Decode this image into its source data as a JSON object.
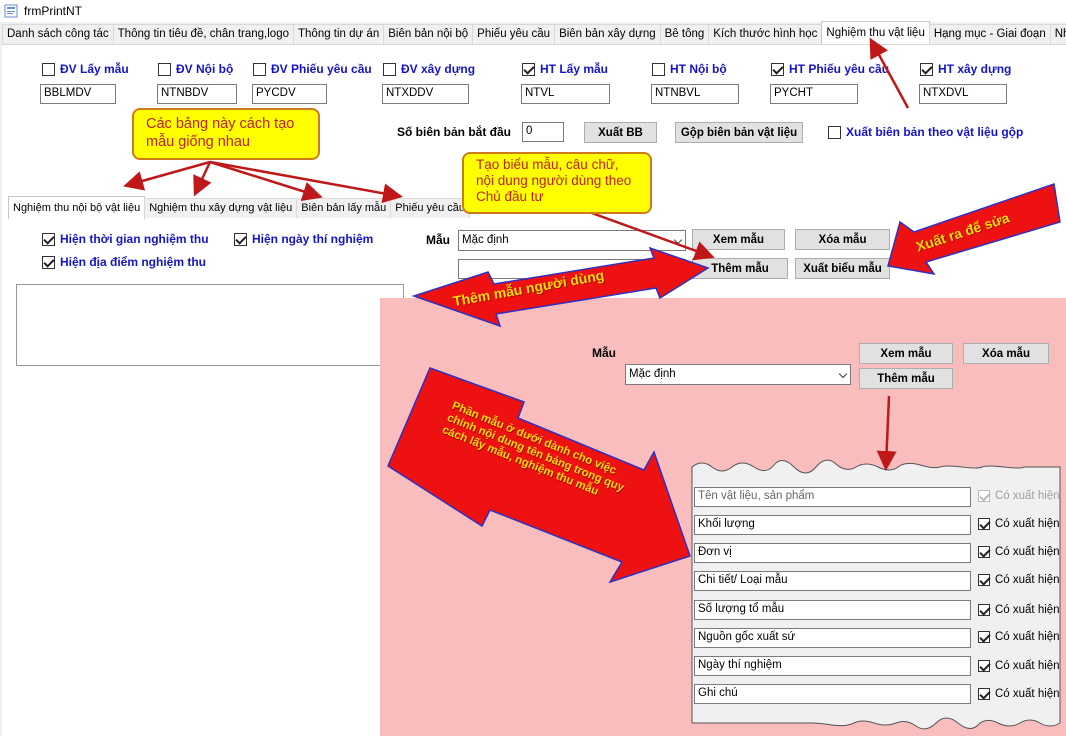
{
  "window": {
    "title": "frmPrintNT"
  },
  "main_tabs": [
    "Danh sách công tác",
    "Thông tin tiêu đề, chân trang,logo",
    "Thông tin dự án",
    "Biên bản nội bộ",
    "Phiếu yêu cầu",
    "Biên bản xây dựng",
    "Bê tông",
    "Kích thước hình học",
    "Nghiệm thu vật liệu",
    "Hạng mục - Giai đoạn",
    "Nhật ký"
  ],
  "active_main_tab": "Nghiệm thu vật liệu",
  "prefix_options": [
    {
      "label": "ĐV Lấy mẫu",
      "checked": false,
      "value": "BBLMDV"
    },
    {
      "label": "ĐV Nội bộ",
      "checked": false,
      "value": "NTNBDV"
    },
    {
      "label": "ĐV Phiếu yêu cầu",
      "checked": false,
      "value": "PYCDV"
    },
    {
      "label": "ĐV xây dựng",
      "checked": false,
      "value": "NTXDDV"
    },
    {
      "label": "HT Lấy mẫu",
      "checked": true,
      "value": "NTVL"
    },
    {
      "label": "HT Nội bộ",
      "checked": false,
      "value": "NTNBVL"
    },
    {
      "label": "HT Phiếu yêu cầu",
      "checked": true,
      "value": "PYCHT"
    },
    {
      "label": "HT xây dựng",
      "checked": true,
      "value": "NTXDVL"
    }
  ],
  "start_number": {
    "label": "Số biên bản bắt đầu",
    "value": "0"
  },
  "buttons": {
    "export_bb": "Xuất BB",
    "merge_bb": "Gộp biên bản vật liệu",
    "view_template": "Xem mẫu",
    "delete_template": "Xóa mẫu",
    "add_template": "Thêm mẫu",
    "export_form": "Xuất biểu mẫu"
  },
  "merge_export": {
    "label": "Xuất biên bản theo vật liệu gộp",
    "checked": false
  },
  "sub_tabs": [
    "Nghiệm thu nội bộ vật liệu",
    "Nghiệm thu xây dựng vật liệu",
    "Biên bản lấy mẫu",
    "Phiếu yêu cầu"
  ],
  "display_options": [
    {
      "label": "Hiện thời gian nghiệm thu",
      "checked": true
    },
    {
      "label": "Hiện ngày thí nghiệm",
      "checked": true
    },
    {
      "label": "Hiện địa điểm nghiệm thu",
      "checked": true
    }
  ],
  "template": {
    "label": "Mẫu",
    "selected": "Mặc định",
    "new_name": ""
  },
  "annotations": {
    "same_tables": "Các bảng này cách tạo mẫu giống nhau",
    "create_template": "Tạo biểu mẫu, câu chữ, nội dung người dùng theo Chủ đầu tư",
    "export_edit": "Xuất ra để sửa",
    "add_user_template": "Thêm mẫu người dùng",
    "lower_part": "Phần mẫu ở dưới dành cho việc chỉnh nội dung tên bảng trong quy cách lấy mẫu, nghiệm thu mẫu"
  },
  "zoom_panel": {
    "template_label": "Mẫu",
    "template_selected": "Mặc định",
    "view_button": "Xem mẫu",
    "delete_button": "Xóa mẫu",
    "add_button": "Thêm mẫu",
    "fields": [
      {
        "name": "Tên vật liệu, sản phẩm",
        "export": true,
        "enabled": false
      },
      {
        "name": "Khối lượng",
        "export": true,
        "enabled": true
      },
      {
        "name": "Đơn vị",
        "export": true,
        "enabled": true
      },
      {
        "name": "Chi tiết/ Loại mẫu",
        "export": true,
        "enabled": true
      },
      {
        "name": "Số lượng tổ mẫu",
        "export": true,
        "enabled": true
      },
      {
        "name": "Nguồn gốc xuất sứ",
        "export": true,
        "enabled": true
      },
      {
        "name": "Ngày thí nghiệm",
        "export": true,
        "enabled": true
      },
      {
        "name": "Ghi chú",
        "export": true,
        "enabled": true
      }
    ],
    "export_label": "Có xuất hiện"
  },
  "colors": {
    "accent_text": "#1414c8",
    "callout_fill": "#ffff00",
    "arrow_red": "#e00000",
    "overlay_pink": "#f9bdbd"
  }
}
